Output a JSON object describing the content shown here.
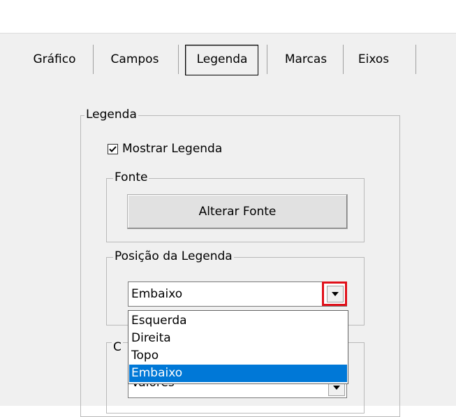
{
  "tabs": [
    {
      "label": "Gráfico"
    },
    {
      "label": "Campos"
    },
    {
      "label": "Legenda",
      "active": true
    },
    {
      "label": "Marcas"
    },
    {
      "label": "Eixos"
    }
  ],
  "legend_group": {
    "title": "Legenda",
    "show_legend_label": "Mostrar Legenda",
    "show_legend_checked": true,
    "font_group": {
      "title": "Fonte",
      "change_font_button": "Alterar Fonte"
    },
    "position_group": {
      "title": "Posição da Legenda",
      "selected_value": "Embaixo",
      "options": [
        "Esquerda",
        "Direita",
        "Topo",
        "Embaixo"
      ]
    },
    "partial_group": {
      "title_fragment": "C",
      "combo_value_fragment": "Valores"
    }
  },
  "colors": {
    "selection_blue": "#0078d7",
    "highlight_red": "#e0101a",
    "dialog_bg": "#f0f0f0"
  }
}
